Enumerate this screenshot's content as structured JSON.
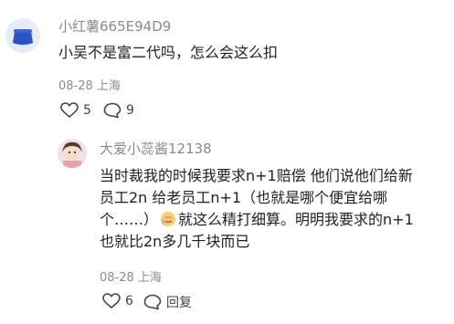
{
  "comment": {
    "username": "小红薯665E94D9",
    "text": "小吴不是富二代吗，怎么会这么扣",
    "meta": "08-28 上海",
    "likes": "5",
    "replies": "9"
  },
  "reply": {
    "username": "大爱小蕊酱12138",
    "line1": "当时裁我的时候我要求n+1赔偿 他们说他们给新",
    "line2": "员工2n 给老员工n+1（也就是哪个便宜给哪",
    "line3_pre": "个……）",
    "line3_post": "就这么精打细算。明明我要求的n+1",
    "line4": "也就比2n多几千块而已",
    "meta": "08-28 上海",
    "likes": "6",
    "reply_label": "回复"
  }
}
